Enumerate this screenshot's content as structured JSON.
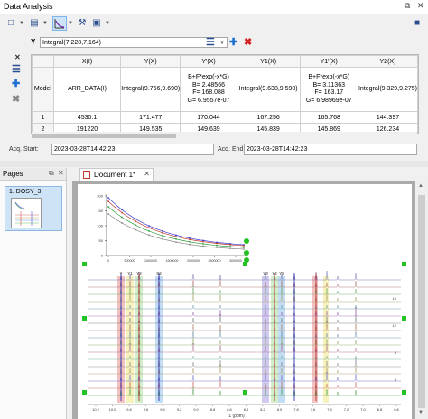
{
  "window": {
    "title": "Data Analysis",
    "pin_icon": "pin-icon",
    "close_icon": "close-icon"
  },
  "toolbar": {
    "buttons": [
      "new-page-icon",
      "table-icon",
      "chart-fit-icon",
      "tools-icon",
      "image-icon"
    ],
    "save_icon": "save-icon"
  },
  "y_selector": {
    "label": "Y",
    "value": "Integral(7.228,7.164)"
  },
  "table": {
    "columns": [
      "",
      "X(I)",
      "Y(X)",
      "Y'(X)",
      "Y1(X)",
      "Y1'(X)",
      "Y2(X)"
    ],
    "model_label": "Model",
    "model_row": [
      "ARR_DATA(I)",
      "Integral(9.766,9.690)",
      "B+F*exp(-x*G)\nB= 2.48566\nF= 168.088\nG= 6.9557e-07",
      "Integral(9.638,9.590)",
      "B+F*exp(-x*G)\nB= 3.11363\nF= 163.17\nG= 6.98969e-07",
      "Integral(9.329,9.275)"
    ],
    "rows": [
      {
        "index": "1",
        "values": [
          "4530.1",
          "171.477",
          "170.044",
          "167.256",
          "165.768",
          "144.397"
        ]
      },
      {
        "index": "2",
        "values": [
          "191220",
          "149.535",
          "149.639",
          "145.839",
          "145.869",
          "126.234"
        ]
      }
    ]
  },
  "acquisition": {
    "start_label": "Acq. Start:",
    "start_value": "2023-03-28T14:42:23",
    "end_label": "Acq. End:",
    "end_value": "2023-03-28T14:42:23"
  },
  "pages_panel": {
    "title": "Pages",
    "items": [
      {
        "label": "1. DOSY_3"
      }
    ]
  },
  "document": {
    "tab_title": "Document 1*"
  },
  "fit_plot": {
    "y_ticks": [
      "200",
      "150",
      "100",
      "50",
      "0"
    ],
    "x_ticks": [
      "0",
      "500000",
      "1000000",
      "1500000",
      "2000000",
      "2500000",
      "3000000"
    ],
    "series": [
      {
        "color": "#3b3bd0"
      },
      {
        "color": "#c0392b"
      },
      {
        "color": "#2e9e3e"
      },
      {
        "color": "#888888"
      }
    ]
  },
  "spectrum": {
    "region_labels": [
      "Y",
      "Y1",
      "Y2",
      "S2",
      "Y3",
      "Y4",
      "Y5"
    ],
    "x_ticks": [
      "10.2",
      "10.0",
      "9.8",
      "9.6",
      "9.4",
      "9.2",
      "9.0",
      "8.8",
      "8.6",
      "8.4",
      "8.2",
      "8.0",
      "7.8",
      "7.6",
      "7.4",
      "7.2",
      "7.0",
      "6.8",
      "6.6"
    ],
    "x_label": "f1 (ppm)",
    "right_ticks": [
      "16",
      "12",
      "8",
      "4"
    ],
    "highlight_colors": [
      "#f2b6b6",
      "#f6efb0",
      "#c9eac0",
      "#b9d7f2",
      "#c9c1ec"
    ]
  }
}
